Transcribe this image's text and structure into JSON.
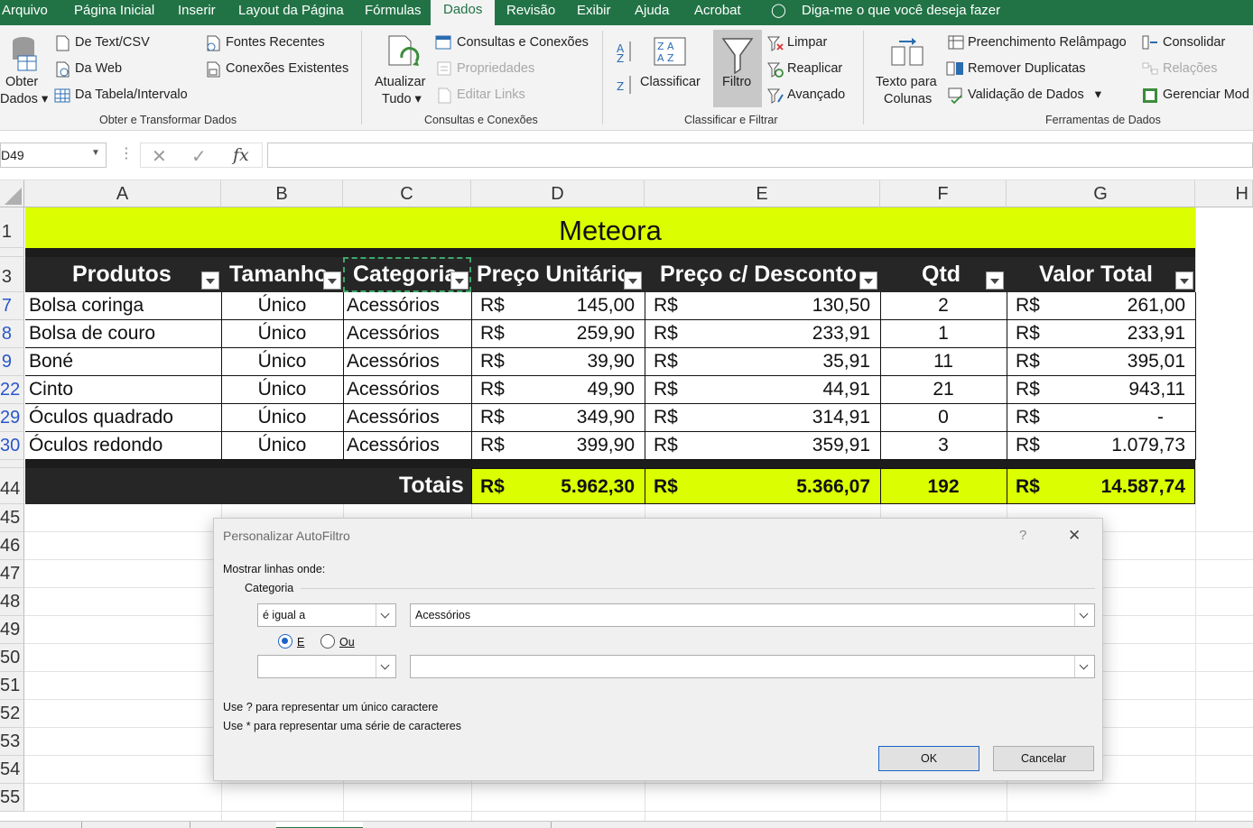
{
  "tabs": [
    "Arquivo",
    "Página Inicial",
    "Inserir",
    "Layout da Página",
    "Fórmulas",
    "Dados",
    "Revisão",
    "Exibir",
    "Ajuda",
    "Acrobat",
    "Diga-me o que você deseja fazer"
  ],
  "ribbon": {
    "obter_dados": [
      "Obter",
      "Dados"
    ],
    "de_text": "De Text/CSV",
    "da_web": "Da Web",
    "da_tabela": "Da Tabela/Intervalo",
    "fontes_recentes": "Fontes Recentes",
    "conexoes_existentes": "Conexões Existentes",
    "group1": "Obter e Transformar Dados",
    "atualizar": [
      "Atualizar",
      "Tudo"
    ],
    "consultas_conexoes": "Consultas e Conexões",
    "propriedades": "Propriedades",
    "editar_links": "Editar Links",
    "group2": "Consultas e Conexões",
    "classificar": "Classificar",
    "filtro": "Filtro",
    "limpar": "Limpar",
    "reaplicar": "Reaplicar",
    "avancado": "Avançado",
    "group3": "Classificar e Filtrar",
    "texto_colunas": [
      "Texto para",
      "Colunas"
    ],
    "preenchimento": "Preenchimento Relâmpago",
    "remover_dup": "Remover Duplicatas",
    "validacao": "Validação de Dados",
    "consolidar": "Consolidar",
    "relacoes": "Relações",
    "gerenciar": "Gerenciar Mod",
    "group4": "Ferramentas de Dados"
  },
  "formula_bar": {
    "name_box": "D49",
    "fx": "fx"
  },
  "columns": [
    "A",
    "B",
    "C",
    "D",
    "E",
    "F",
    "G",
    "H"
  ],
  "row_numbers": [
    "1",
    "3",
    "7",
    "8",
    "9",
    "22",
    "29",
    "30",
    "44",
    "45",
    "46",
    "47",
    "48",
    "49",
    "50",
    "51",
    "52",
    "53",
    "54",
    "55"
  ],
  "sheet": {
    "title": "Meteora",
    "headers": [
      "Produtos",
      "Tamanho",
      "Categoria",
      "Preço Unitário",
      "Preço c/ Desconto",
      "Qtd",
      "Valor Total"
    ],
    "currency": "R$",
    "rows": [
      {
        "produto": "Bolsa coringa",
        "tamanho": "Único",
        "categoria": "Acessórios",
        "preco": "145,00",
        "desconto": "130,50",
        "qtd": "2",
        "total": "261,00"
      },
      {
        "produto": "Bolsa de couro",
        "tamanho": "Único",
        "categoria": "Acessórios",
        "preco": "259,90",
        "desconto": "233,91",
        "qtd": "1",
        "total": "233,91"
      },
      {
        "produto": "Boné",
        "tamanho": "Único",
        "categoria": "Acessórios",
        "preco": "39,90",
        "desconto": "35,91",
        "qtd": "11",
        "total": "395,01"
      },
      {
        "produto": "Cinto",
        "tamanho": "Único",
        "categoria": "Acessórios",
        "preco": "49,90",
        "desconto": "44,91",
        "qtd": "21",
        "total": "943,11"
      },
      {
        "produto": "Óculos quadrado",
        "tamanho": "Único",
        "categoria": "Acessórios",
        "preco": "349,90",
        "desconto": "314,91",
        "qtd": "0",
        "total": "-"
      },
      {
        "produto": "Óculos redondo",
        "tamanho": "Único",
        "categoria": "Acessórios",
        "preco": "399,90",
        "desconto": "359,91",
        "qtd": "3",
        "total": "1.079,73"
      }
    ],
    "totals": {
      "label": "Totais",
      "preco": "5.962,30",
      "desconto": "5.366,07",
      "qtd": "192",
      "total": "14.587,74"
    }
  },
  "dialog": {
    "title": "Personalizar AutoFiltro",
    "help": "?",
    "close": "✕",
    "show_rows": "Mostrar linhas onde:",
    "field": "Categoria",
    "op1": "é igual a",
    "val1": "Acessórios",
    "and_label": "E",
    "or_label": "Ou",
    "op2": "",
    "val2": "",
    "hint1": "Use ? para representar um único caractere",
    "hint2": "Use * para representar uma série de caracteres",
    "ok": "OK",
    "cancel": "Cancelar"
  }
}
